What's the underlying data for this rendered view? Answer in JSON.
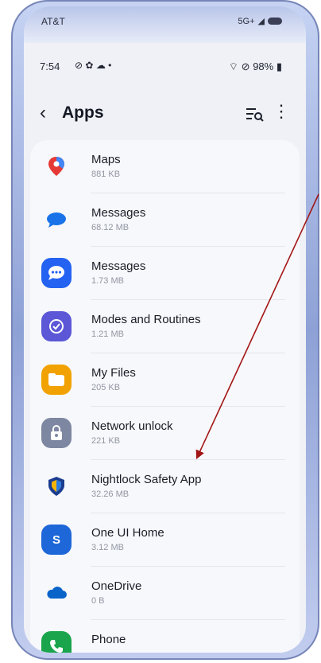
{
  "carrier": {
    "name": "AT&T",
    "network": "5G+"
  },
  "statusbar": {
    "time": "7:54",
    "battery": "98%"
  },
  "appbar": {
    "title": "Apps",
    "back_icon": "back-arrow-icon",
    "search_icon": "list-search-icon",
    "more_icon": "more-vert-icon"
  },
  "apps": [
    {
      "name": "Maps",
      "size": "881 KB",
      "icon": "maps-pin-icon",
      "color": "#e53935"
    },
    {
      "name": "Messages",
      "size": "68.12 MB",
      "icon": "messages-bubble-icon",
      "color": "#1a73e8"
    },
    {
      "name": "Messages",
      "size": "1.73 MB",
      "icon": "messages-dots-icon",
      "color": "#2462f2"
    },
    {
      "name": "Modes and Routines",
      "size": "1.21 MB",
      "icon": "modes-check-icon",
      "color": "#5b57d6"
    },
    {
      "name": "My Files",
      "size": "205 KB",
      "icon": "folder-icon",
      "color": "#f2a200"
    },
    {
      "name": "Network unlock",
      "size": "221 KB",
      "icon": "lock-icon",
      "color": "#7e87a2"
    },
    {
      "name": "Nightlock Safety App",
      "size": "32.26 MB",
      "icon": "shield-icon",
      "color": "#2a7be4"
    },
    {
      "name": "One UI Home",
      "size": "3.12 MB",
      "icon": "oneui-home-icon",
      "color": "#1e67d9"
    },
    {
      "name": "OneDrive",
      "size": "0 B",
      "icon": "cloud-icon",
      "color": "#0a63c9"
    },
    {
      "name": "Phone",
      "size": "",
      "icon": "phone-icon",
      "color": "#1aa54c"
    }
  ],
  "annotation": {
    "arrow_color": "#a31515"
  }
}
